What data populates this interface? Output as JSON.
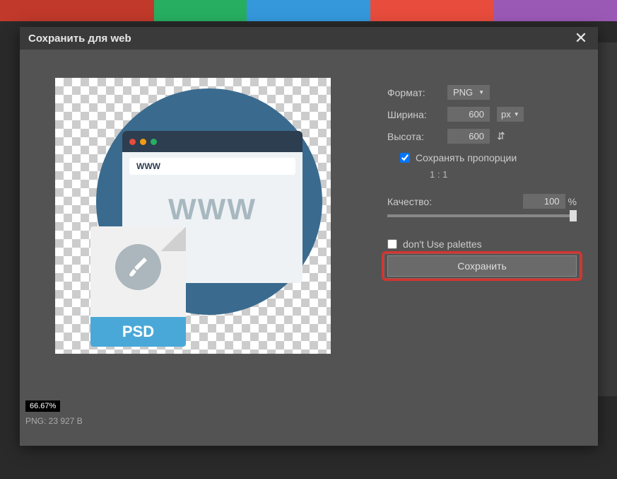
{
  "dialog": {
    "title": "Сохранить для web"
  },
  "settings": {
    "format_label": "Формат:",
    "format_value": "PNG",
    "width_label": "Ширина:",
    "width_value": "600",
    "width_unit": "px",
    "height_label": "Высота:",
    "height_value": "600",
    "keep_proportions_label": "Сохранять пропорции",
    "keep_proportions_checked": true,
    "ratio_text": "1 : 1",
    "quality_label": "Качество:",
    "quality_value": "100",
    "quality_unit": "%",
    "palettes_label": "don't Use palettes",
    "palettes_checked": false,
    "save_button": "Сохранить"
  },
  "preview": {
    "url_text": "WWW",
    "www_text": "WWW",
    "psd_label": "PSD"
  },
  "status": {
    "zoom": "66.67%",
    "file_info": "PNG: 23 927 B"
  },
  "colors": {
    "dot_red": "#e74c3c",
    "dot_yellow": "#f39c12",
    "dot_green": "#27ae60"
  }
}
